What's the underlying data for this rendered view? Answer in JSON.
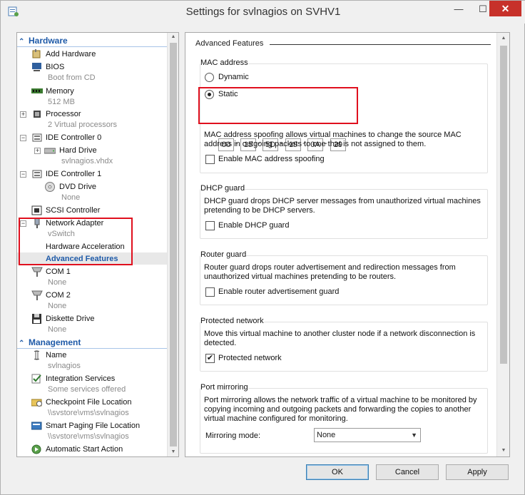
{
  "window": {
    "title": "Settings for svlnagios on SVHV1",
    "minimize": "—",
    "maximize": "☐",
    "close": "✕"
  },
  "sidebar": {
    "hardware_heading": "Hardware",
    "management_heading": "Management",
    "hardware": {
      "add_hardware": "Add Hardware",
      "bios": "BIOS",
      "bios_sub": "Boot from CD",
      "memory": "Memory",
      "memory_sub": "512 MB",
      "processor": "Processor",
      "processor_sub": "2 Virtual processors",
      "ide0": "IDE Controller 0",
      "hard_drive": "Hard Drive",
      "hard_drive_sub": "svlnagios.vhdx",
      "ide1": "IDE Controller 1",
      "dvd_drive": "DVD Drive",
      "dvd_drive_sub": "None",
      "scsi": "SCSI Controller",
      "network_adapter": "Network Adapter",
      "network_adapter_sub": "vSwitch",
      "hw_accel": "Hardware Acceleration",
      "adv_features": "Advanced Features",
      "com1": "COM 1",
      "com1_sub": "None",
      "com2": "COM 2",
      "com2_sub": "None",
      "diskette": "Diskette Drive",
      "diskette_sub": "None"
    },
    "management": {
      "name": "Name",
      "name_sub": "svlnagios",
      "integration": "Integration Services",
      "integration_sub": "Some services offered",
      "checkpoint": "Checkpoint File Location",
      "checkpoint_sub": "\\\\svstore\\vms\\svlnagios",
      "smart_paging": "Smart Paging File Location",
      "smart_paging_sub": "\\\\svstore\\vms\\svlnagios",
      "auto_start": "Automatic Start Action"
    }
  },
  "pane": {
    "title": "Advanced Features",
    "mac": {
      "group_title": "MAC address",
      "dynamic_label": "Dynamic",
      "static_label": "Static",
      "selected": "Static",
      "octets": [
        "00",
        "15",
        "5D",
        "19",
        "0A",
        "29"
      ],
      "spoof_desc_1": "MAC address spoofing allows virtual machines to change the source MAC",
      "spoof_desc_2": "address in outgoing packets to one that is not assigned to them.",
      "spoof_label": "Enable MAC address spoofing",
      "spoof_checked": false
    },
    "dhcp": {
      "group_title": "DHCP guard",
      "desc_1": "DHCP guard drops DHCP server messages from unauthorized virtual machines",
      "desc_2": "pretending to be DHCP servers.",
      "label": "Enable DHCP guard",
      "checked": false
    },
    "router": {
      "group_title": "Router guard",
      "desc_1": "Router guard drops router advertisement and redirection messages from",
      "desc_2": "unauthorized virtual machines pretending to be routers.",
      "label": "Enable router advertisement guard",
      "checked": false
    },
    "protected": {
      "group_title": "Protected network",
      "desc_1": "Move this virtual machine to another cluster node if a network disconnection is",
      "desc_2": "detected.",
      "label": "Protected network",
      "checked": true,
      "check_glyph": "✔"
    },
    "mirror": {
      "group_title": "Port mirroring",
      "desc_1": "Port mirroring allows the network traffic of a virtual machine to be monitored by",
      "desc_2": "copying incoming and outgoing packets and forwarding the copies to another",
      "desc_3": "virtual machine configured for monitoring.",
      "mode_label": "Mirroring mode:",
      "mode_value": "None"
    }
  },
  "buttons": {
    "ok": "OK",
    "cancel": "Cancel",
    "apply": "Apply"
  },
  "colors": {
    "accent": "#1e5aa8",
    "highlight_box": "#e0101e",
    "close": "#c7312a"
  }
}
